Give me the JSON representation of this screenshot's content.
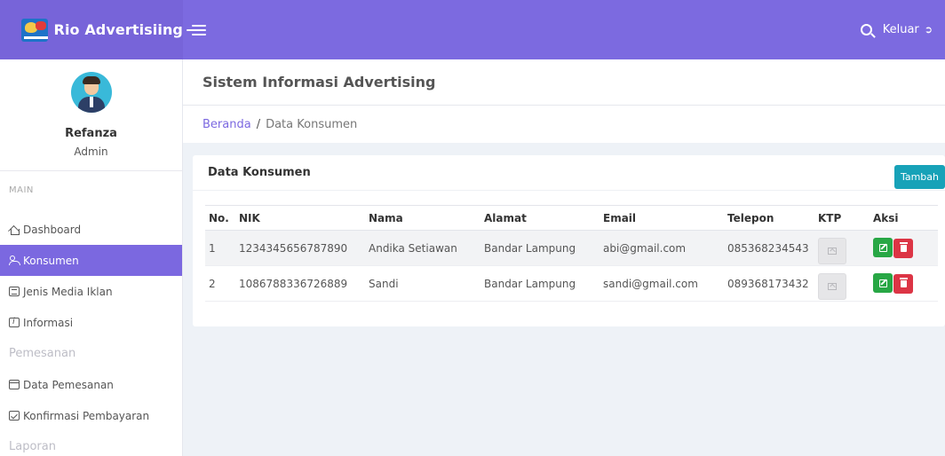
{
  "brand": {
    "title": "Rio Advertisiing"
  },
  "nav": {
    "logout_label": "Keluar"
  },
  "profile": {
    "name": "Refanza",
    "role": "Admin"
  },
  "sidebar": {
    "main_heading": "MAIN",
    "items": [
      {
        "label": "Dashboard",
        "icon": "home-icon",
        "active": false
      },
      {
        "label": "Konsumen",
        "icon": "users-icon",
        "active": true
      },
      {
        "label": "Jenis Media Iklan",
        "icon": "list-icon",
        "active": false
      },
      {
        "label": "Informasi",
        "icon": "info-icon",
        "active": false
      }
    ],
    "group_pemesanan": "Pemesanan",
    "pemesanan_items": [
      {
        "label": "Data Pemesanan",
        "icon": "archive-icon"
      },
      {
        "label": "Konfirmasi Pembayaran",
        "icon": "check-square-icon"
      }
    ],
    "group_laporan": "Laporan"
  },
  "page": {
    "title": "Sistem Informasi Advertising"
  },
  "breadcrumb": {
    "home": "Beranda",
    "separator": "/",
    "current": "Data Konsumen"
  },
  "card": {
    "title": "Data Konsumen",
    "add_label": "Tambah"
  },
  "table": {
    "headers": [
      "No.",
      "NIK",
      "Nama",
      "Alamat",
      "Email",
      "Telepon",
      "KTP",
      "Aksi"
    ],
    "rows": [
      {
        "no": "1",
        "nik": "1234345656787890",
        "nama": "Andika Setiawan",
        "alamat": "Bandar Lampung",
        "email": "abi@gmail.com",
        "telepon": "085368234543"
      },
      {
        "no": "2",
        "nik": "1086788336726889",
        "nama": "Sandi",
        "alamat": "Bandar Lampung",
        "email": "sandi@gmail.com",
        "telepon": "089368173432"
      }
    ]
  },
  "colors": {
    "brand_purple": "#7764d9",
    "topbar_purple": "#7c6ae0",
    "active_menu": "#7b68e0",
    "add_button": "#17a2b8",
    "edit_button": "#28a745",
    "delete_button": "#dc3545"
  }
}
